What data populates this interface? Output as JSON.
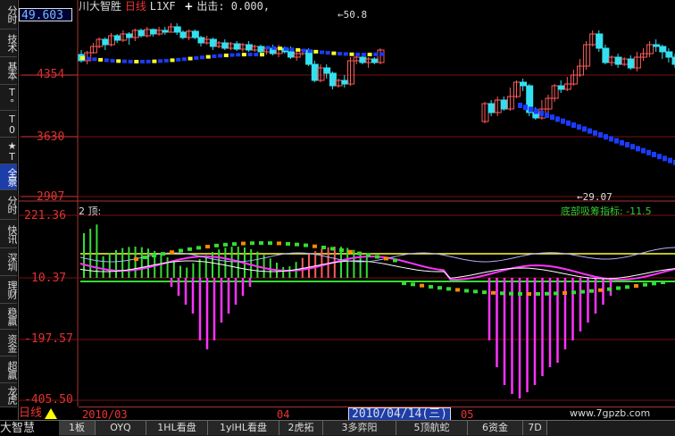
{
  "header": {
    "stock_name": "川大智胜",
    "period": "日线",
    "indicator": "L1XF",
    "output": "出击: 0.000,"
  },
  "top_value": "49.603",
  "price_axis": [
    "4354",
    "3630",
    "2907"
  ],
  "osc_axis": [
    "221.36",
    "10.37",
    "-197.57",
    "-405.50"
  ],
  "annotations": {
    "high": "←50.8",
    "low": "←29.07"
  },
  "osc_title": "2 顶:",
  "osc_indicator": "底部吸筹指标: -11.5",
  "period_bar": "日线",
  "dates": [
    "2010/03",
    "04",
    "05"
  ],
  "date_cursor": "2010/04/14(三)",
  "watermark": "www.7gpzb.com",
  "sidebar": [
    {
      "label": "分时",
      "active": false
    },
    {
      "label": "技术",
      "active": false
    },
    {
      "label": "基本",
      "active": false
    },
    {
      "label": "T°",
      "active": false
    },
    {
      "label": "T0",
      "active": false
    },
    {
      "label": "★T",
      "active": false
    },
    {
      "label": "全景",
      "active": true
    },
    {
      "label": "分时",
      "active": false
    },
    {
      "label": "快讯",
      "active": false
    },
    {
      "label": "深圳",
      "active": false
    },
    {
      "label": "理财",
      "active": false
    },
    {
      "label": "稳赢",
      "active": false
    },
    {
      "label": "资金",
      "active": false
    },
    {
      "label": "超赢",
      "active": false
    },
    {
      "label": "龙虎",
      "active": false
    }
  ],
  "brand": "大智慧",
  "tabs": [
    "1板",
    "OYQ",
    "1HL看盘",
    "1ylHL看盘",
    "2虎拓",
    "3多弈阳",
    "5顶航蛇",
    "6资金",
    "7D"
  ],
  "colors": {
    "up_candle": "#ff5a5a",
    "down_candle": "#33e0f0",
    "yellow": "#ffff33",
    "blue": "#1a3cff",
    "magenta": "#ff33ff",
    "green": "#33dd33",
    "grid_red": "#7a1010"
  },
  "candles_segment1": [
    [
      51,
      44,
      56,
      42
    ],
    [
      44,
      53,
      55,
      40
    ],
    [
      53,
      60,
      64,
      52
    ],
    [
      60,
      68,
      70,
      58
    ],
    [
      68,
      62,
      70,
      56
    ],
    [
      62,
      72,
      75,
      60
    ],
    [
      72,
      67,
      74,
      64
    ],
    [
      67,
      74,
      78,
      65
    ],
    [
      74,
      70,
      76,
      62
    ],
    [
      70,
      78,
      80,
      66
    ],
    [
      78,
      72,
      80,
      70
    ],
    [
      72,
      79,
      82,
      70
    ],
    [
      79,
      74,
      80,
      71
    ],
    [
      74,
      78,
      82,
      72
    ],
    [
      78,
      76,
      82,
      73
    ],
    [
      76,
      82,
      86,
      76
    ],
    [
      82,
      76,
      86,
      73
    ],
    [
      76,
      70,
      78,
      68
    ],
    [
      70,
      77,
      79,
      67
    ],
    [
      77,
      70,
      79,
      68
    ],
    [
      70,
      64,
      72,
      60
    ],
    [
      64,
      68,
      72,
      62
    ],
    [
      68,
      60,
      70,
      56
    ],
    [
      60,
      64,
      66,
      58
    ],
    [
      64,
      58,
      68,
      56
    ],
    [
      58,
      63,
      65,
      56
    ],
    [
      63,
      57,
      66,
      55
    ],
    [
      57,
      62,
      64,
      54
    ],
    [
      62,
      56,
      66,
      54
    ],
    [
      56,
      60,
      62,
      54
    ],
    [
      60,
      54,
      62,
      50
    ],
    [
      54,
      58,
      60,
      51
    ],
    [
      58,
      52,
      62,
      50
    ],
    [
      52,
      58,
      62,
      48
    ],
    [
      58,
      54,
      60,
      52
    ],
    [
      54,
      48,
      60,
      46
    ],
    [
      48,
      52,
      54,
      44
    ],
    [
      52,
      56,
      57,
      50
    ],
    [
      56,
      40,
      58,
      38
    ],
    [
      40,
      22,
      44,
      20
    ],
    [
      22,
      36,
      40,
      20
    ],
    [
      36,
      30,
      40,
      24
    ],
    [
      30,
      16,
      32,
      12
    ],
    [
      16,
      22,
      24,
      14
    ],
    [
      22,
      18,
      28,
      14
    ],
    [
      18,
      44,
      48,
      16
    ],
    [
      44,
      48,
      52,
      40
    ],
    [
      48,
      42,
      52,
      40
    ],
    [
      42,
      46,
      48,
      36
    ],
    [
      46,
      42,
      48,
      40
    ],
    [
      42,
      56,
      58,
      40
    ]
  ],
  "candles_segment2": [
    [
      114,
      134,
      136,
      112
    ],
    [
      134,
      124,
      138,
      120
    ],
    [
      124,
      138,
      142,
      120
    ],
    [
      138,
      128,
      142,
      126
    ],
    [
      128,
      142,
      152,
      126
    ],
    [
      142,
      158,
      160,
      140
    ],
    [
      158,
      154,
      162,
      148
    ],
    [
      154,
      124,
      156,
      120
    ],
    [
      124,
      118,
      130,
      116
    ],
    [
      118,
      128,
      138,
      116
    ],
    [
      128,
      140,
      144,
      118
    ],
    [
      140,
      154,
      156,
      136
    ],
    [
      154,
      150,
      160,
      146
    ],
    [
      150,
      156,
      164,
      148
    ],
    [
      156,
      166,
      172,
      154
    ],
    [
      166,
      176,
      184,
      164
    ],
    [
      176,
      200,
      204,
      172
    ],
    [
      200,
      212,
      216,
      198
    ],
    [
      212,
      196,
      216,
      192
    ],
    [
      196,
      180,
      200,
      178
    ],
    [
      180,
      186,
      188,
      176
    ],
    [
      186,
      178,
      190,
      174
    ],
    [
      178,
      184,
      186,
      176
    ],
    [
      184,
      174,
      188,
      172
    ],
    [
      174,
      186,
      192,
      170
    ],
    [
      186,
      190,
      196,
      182
    ],
    [
      190,
      200,
      204,
      186
    ],
    [
      200,
      198,
      206,
      192
    ],
    [
      198,
      192,
      200,
      184
    ],
    [
      192,
      186,
      196,
      180
    ],
    [
      186,
      178,
      190,
      174
    ],
    [
      178,
      158,
      180,
      154
    ]
  ]
}
